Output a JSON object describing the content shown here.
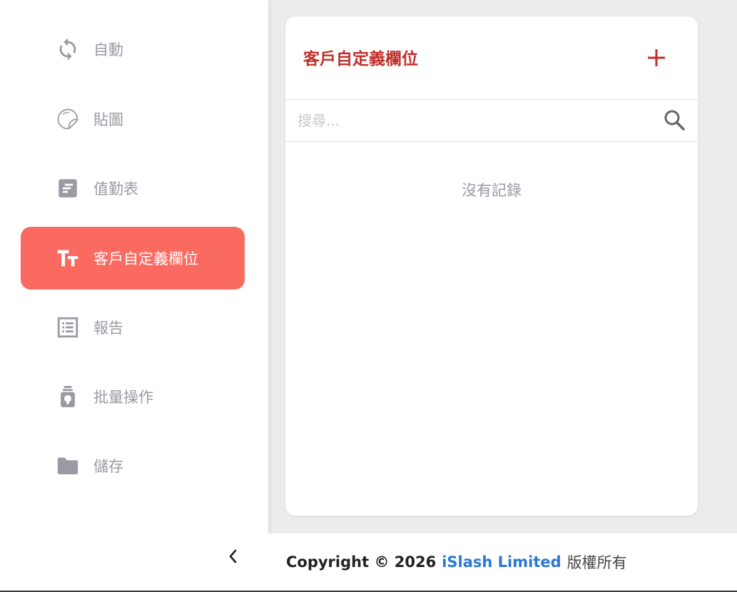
{
  "colors": {
    "accent": "#fa6a61",
    "title_red": "#c0302a",
    "link_blue": "#2a78d6",
    "muted_text": "#9b9aa3"
  },
  "sidebar": {
    "items": [
      {
        "label": "自動",
        "icon": "sync-icon"
      },
      {
        "label": "貼圖",
        "icon": "sticker-icon"
      },
      {
        "label": "值勤表",
        "icon": "roster-icon"
      },
      {
        "label": "客戶自定義欄位",
        "icon": "text-format-icon",
        "active": true
      },
      {
        "label": "報告",
        "icon": "report-list-icon"
      },
      {
        "label": "批量操作",
        "icon": "bulk-action-icon"
      },
      {
        "label": "儲存",
        "icon": "folder-icon"
      }
    ],
    "collapse_icon": "chevron-left-icon"
  },
  "card": {
    "title": "客戶自定義欄位",
    "add_icon": "plus-icon",
    "search": {
      "placeholder": "搜尋...",
      "value": ""
    },
    "empty_text": "沒有記錄"
  },
  "footer": {
    "copyright": "Copyright © 2026",
    "company": "iSlash Limited",
    "rights": "版權所有"
  }
}
